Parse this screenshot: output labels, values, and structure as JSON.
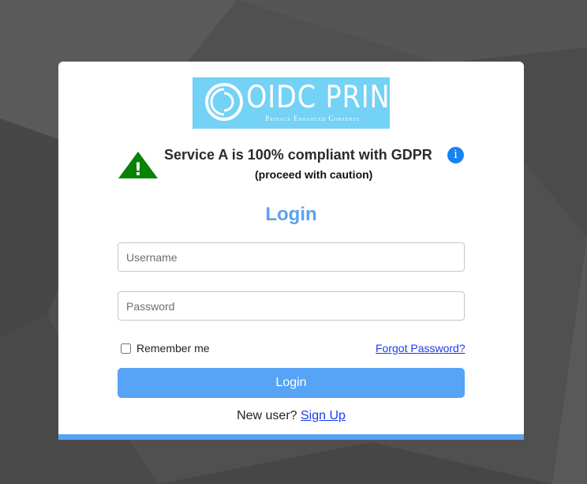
{
  "logo": {
    "title": "OIDC PRINCE",
    "subtitle": "Privacy Enhanced Consents"
  },
  "compliance": {
    "title": "Service A is 100% compliant with GDPR",
    "subtitle": "(proceed with caution)",
    "warning_symbol": "!",
    "info_symbol": "i",
    "warning_icon": "warning-triangle-icon",
    "info_icon": "info-circle-icon"
  },
  "login": {
    "heading": "Login",
    "username_placeholder": "Username",
    "password_placeholder": "Password",
    "remember_label": "Remember me",
    "forgot_label": "Forgot Password?",
    "button_label": "Login",
    "new_user_text": "New user? ",
    "signup_label": "Sign Up"
  },
  "colors": {
    "background": "#4d4d4d",
    "card": "#ffffff",
    "accent": "#57a3f5",
    "heading": "#5aa2ee",
    "logo_bg": "#73d2f5",
    "warning_green": "#078207",
    "info_blue": "#1783f0",
    "link": "#1a3cf0"
  }
}
